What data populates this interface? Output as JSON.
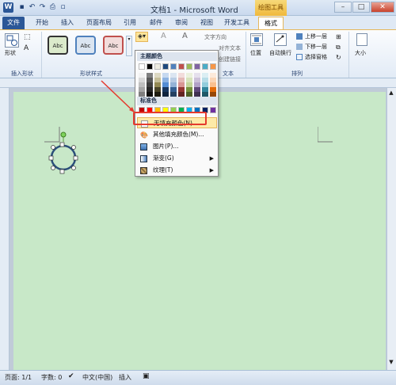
{
  "window": {
    "title": "文档1 - Microsoft Word",
    "app_icon": "W",
    "context_tab_group": "绘图工具",
    "minimize": "–",
    "maximize": "□",
    "close": "✕"
  },
  "quick_access": [
    "save-icon",
    "undo-icon",
    "redo-icon",
    "print-icon",
    "new-icon"
  ],
  "tabs": [
    "文件",
    "开始",
    "插入",
    "页面布局",
    "引用",
    "邮件",
    "审阅",
    "视图",
    "开发工具",
    "格式"
  ],
  "ribbon": {
    "shape_label": "形状",
    "insert_shape_group": "插入形状",
    "style_sample": "Abc",
    "shape_styles_group": "形状样式",
    "text_direction": "文字方向",
    "align_text": "对齐文本",
    "create_link": "创建链接",
    "text_group": "文本",
    "position": "位置",
    "wrap_text": "自动换行",
    "bring_forward": "上移一层",
    "send_backward": "下移一层",
    "selection_pane": "选择窗格",
    "arrange_group": "排列",
    "size": "大小"
  },
  "dropdown": {
    "theme_colors_header": "主题颜色",
    "standard_colors_header": "标准色",
    "items": [
      "无填充颜色(N)",
      "其他填充颜色(M)...",
      "图片(P)...",
      "渐变(G)",
      "纹理(T)"
    ],
    "theme_top": [
      "#ffffff",
      "#000000",
      "#eeece1",
      "#1f497d",
      "#4f81bd",
      "#c0504d",
      "#9bbb59",
      "#8064a2",
      "#4bacc6",
      "#f79646"
    ],
    "theme_shades": [
      [
        "#f2f2f2",
        "#7f7f7f",
        "#ddd9c3",
        "#c6d9f0",
        "#dbe5f1",
        "#f2dcdb",
        "#ebf1dd",
        "#e5e0ec",
        "#dbeef3",
        "#fdeada"
      ],
      [
        "#d8d8d8",
        "#595959",
        "#c4bd97",
        "#8db3e2",
        "#b8cce4",
        "#e5b9b7",
        "#d7e3bc",
        "#ccc1d9",
        "#b7dde8",
        "#fbd5b5"
      ],
      [
        "#bfbfbf",
        "#3f3f3f",
        "#938953",
        "#548dd4",
        "#95b3d7",
        "#d99694",
        "#c3d69b",
        "#b2a2c7",
        "#92cddc",
        "#fac08f"
      ],
      [
        "#a5a5a5",
        "#262626",
        "#494429",
        "#17365d",
        "#366092",
        "#953734",
        "#76923c",
        "#5f497a",
        "#31859b",
        "#e36c09"
      ],
      [
        "#7f7f7f",
        "#0c0c0c",
        "#1d1b10",
        "#0f243e",
        "#244061",
        "#632423",
        "#4f6128",
        "#3f3151",
        "#205867",
        "#974806"
      ]
    ],
    "standard": [
      "#c00000",
      "#ff0000",
      "#ffc000",
      "#ffff00",
      "#92d050",
      "#00b050",
      "#00b0f0",
      "#0070c0",
      "#002060",
      "#7030a0"
    ]
  },
  "status": {
    "page": "页面: 1/1",
    "words": "字数: 0",
    "language": "中文(中国)",
    "mode": "插入"
  },
  "colors": {
    "page_bg": "#c8e8c8",
    "accent": "#2b5797",
    "highlight": "#e53a2e"
  }
}
